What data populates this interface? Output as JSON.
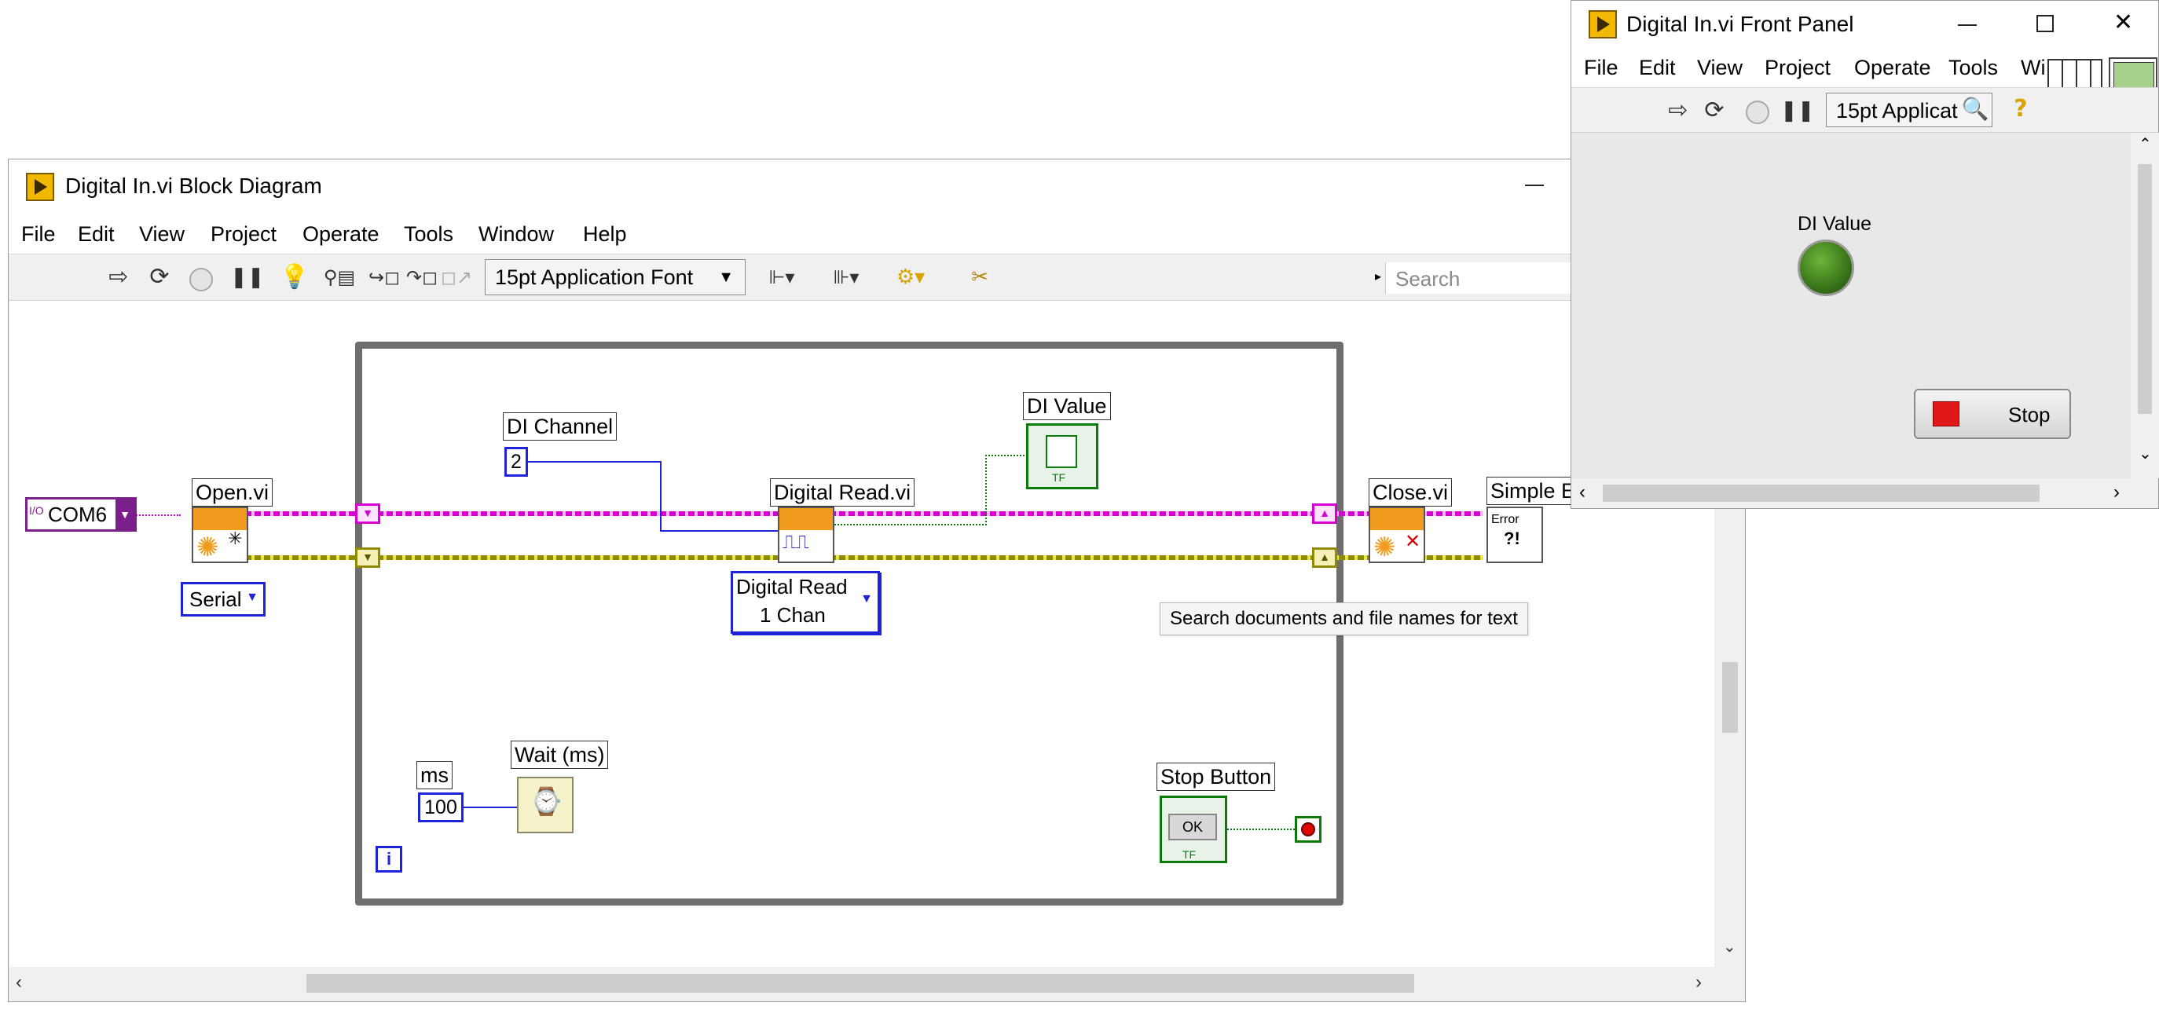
{
  "block_diagram": {
    "title": "Digital In.vi Block Diagram",
    "menu": [
      "File",
      "Edit",
      "View",
      "Project",
      "Operate",
      "Tools",
      "Window",
      "Help"
    ],
    "font_dropdown": "15pt Application Font",
    "search_placeholder": "Search",
    "nodes": {
      "com_port": "COM6",
      "io_glyph": "I/O",
      "open_vi": "Open.vi",
      "serial_selector": "Serial",
      "di_channel_label": "DI Channel",
      "di_channel_value": "2",
      "digital_read_label": "Digital Read.vi",
      "digital_read_selector_line1": "Digital Read",
      "digital_read_selector_line2": "1 Chan",
      "di_value_label": "DI Value",
      "close_vi": "Close.vi",
      "simple_error": "Simple Er",
      "error_glyph": "Error",
      "ms_label": "ms",
      "ms_value": "100",
      "wait_label": "Wait (ms)",
      "stop_button_label": "Stop Button",
      "stop_ok": "OK",
      "iteration": "i",
      "tf": "TF"
    },
    "tooltip": "Search documents and file names for text"
  },
  "front_panel": {
    "title": "Digital In.vi Front Panel",
    "menu": [
      "File",
      "Edit",
      "View",
      "Project",
      "Operate",
      "Tools",
      "Wi"
    ],
    "font_dropdown": "15pt Applicat",
    "di_value_label": "DI Value",
    "stop_button": "Stop",
    "led_state": "on",
    "led_color": "#3d7a1c"
  },
  "colors": {
    "visa_wire": "#d400d4",
    "error_wire": "#c9c400",
    "numeric_wire": "#1e22d8",
    "boolean_wire": "#0a7a0a",
    "loop_border": "#6e6e6e"
  }
}
